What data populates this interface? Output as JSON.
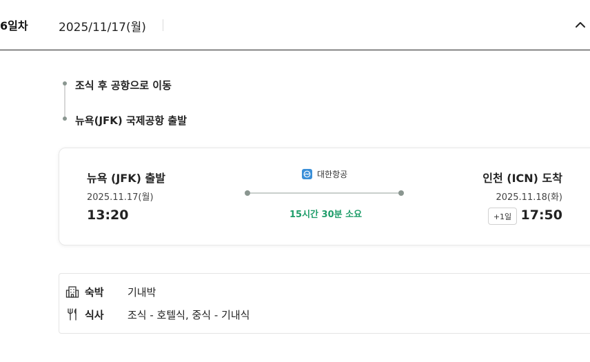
{
  "day": {
    "label": "6일차",
    "date": "2025/11/17(월)",
    "collapse_icon": "chevron-up-icon"
  },
  "timeline": {
    "items": [
      {
        "text": "조식 후 공항으로 이동"
      },
      {
        "text": "뉴욕(JFK) 국제공항 출발"
      }
    ]
  },
  "flight": {
    "departure": {
      "title": "뉴욕 (JFK) 출발",
      "date": "2025.11.17(월)",
      "time": "13:20"
    },
    "airline": {
      "name": "대한항공",
      "logo_icon": "korean-air-logo-icon",
      "logo_color": "#3a8fd8"
    },
    "duration": "15시간 30분 소요",
    "duration_color": "#1f9d6a",
    "arrival": {
      "title": "인천 (ICN) 도착",
      "date": "2025.11.18(화)",
      "day_offset": "+1일",
      "time": "17:50"
    }
  },
  "info": {
    "lodging": {
      "icon": "building-icon",
      "label": "숙박",
      "value": "기내박"
    },
    "meal": {
      "icon": "utensils-icon",
      "label": "식사",
      "value": "조식 - 호텔식, 중식 - 기내식"
    }
  }
}
